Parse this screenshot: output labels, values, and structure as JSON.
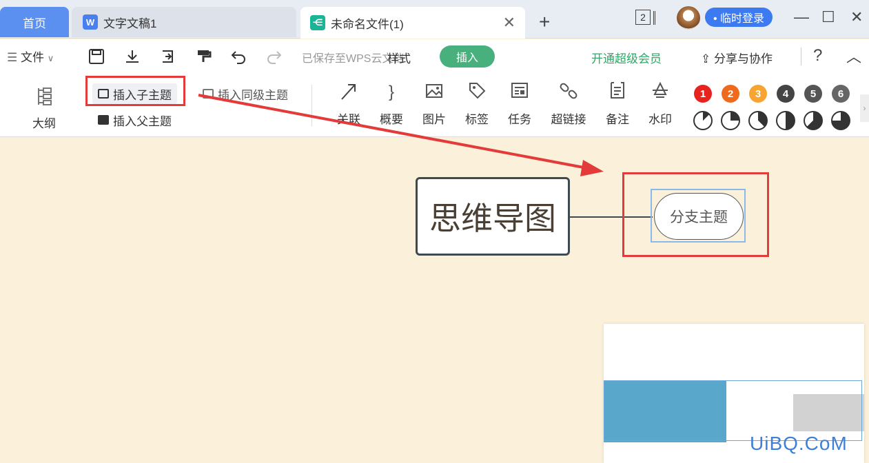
{
  "tabs": {
    "home": "首页",
    "doc": "文字文稿1",
    "mindmap": "未命名文件(1)"
  },
  "title_bar": {
    "window_count": "2",
    "login": "• 临时登录"
  },
  "menu": {
    "file": "文件",
    "saved_status": "已保存至WPS云文档",
    "tab_style": "样式",
    "tab_insert": "插入",
    "vip": "开通超级会员",
    "share": "分享与协作",
    "help": "?"
  },
  "ribbon": {
    "outline": "大纲",
    "insert_child": "插入子主题",
    "insert_sibling": "插入同级主题",
    "insert_parent": "插入父主题",
    "tools": [
      {
        "label": "关联",
        "icon": "relation-arrow-icon"
      },
      {
        "label": "概要",
        "icon": "summary-brace-icon"
      },
      {
        "label": "图片",
        "icon": "image-icon"
      },
      {
        "label": "标签",
        "icon": "tag-icon"
      },
      {
        "label": "任务",
        "icon": "task-icon"
      },
      {
        "label": "超链接",
        "icon": "hyperlink-icon"
      },
      {
        "label": "备注",
        "icon": "note-icon"
      },
      {
        "label": "水印",
        "icon": "watermark-icon"
      }
    ],
    "priorities": [
      {
        "label": "1",
        "color": "#e8231f"
      },
      {
        "label": "2",
        "color": "#f06a1d"
      },
      {
        "label": "3",
        "color": "#f7a432"
      },
      {
        "label": "4",
        "color": "#444444"
      },
      {
        "label": "5",
        "color": "#555555"
      },
      {
        "label": "6",
        "color": "#666666"
      }
    ],
    "progress_levels": [
      0.125,
      0.25,
      0.375,
      0.5,
      0.625,
      0.75
    ]
  },
  "canvas": {
    "root_topic": "思维导图",
    "branch_topic": "分支主题"
  },
  "watermark_text": "UiBQ.CoM",
  "colors": {
    "accent_blue": "#3b7af0",
    "insert_tab_green": "#47b07d",
    "annotation_red": "#e33a3a",
    "canvas_bg": "#fbf0d9"
  }
}
